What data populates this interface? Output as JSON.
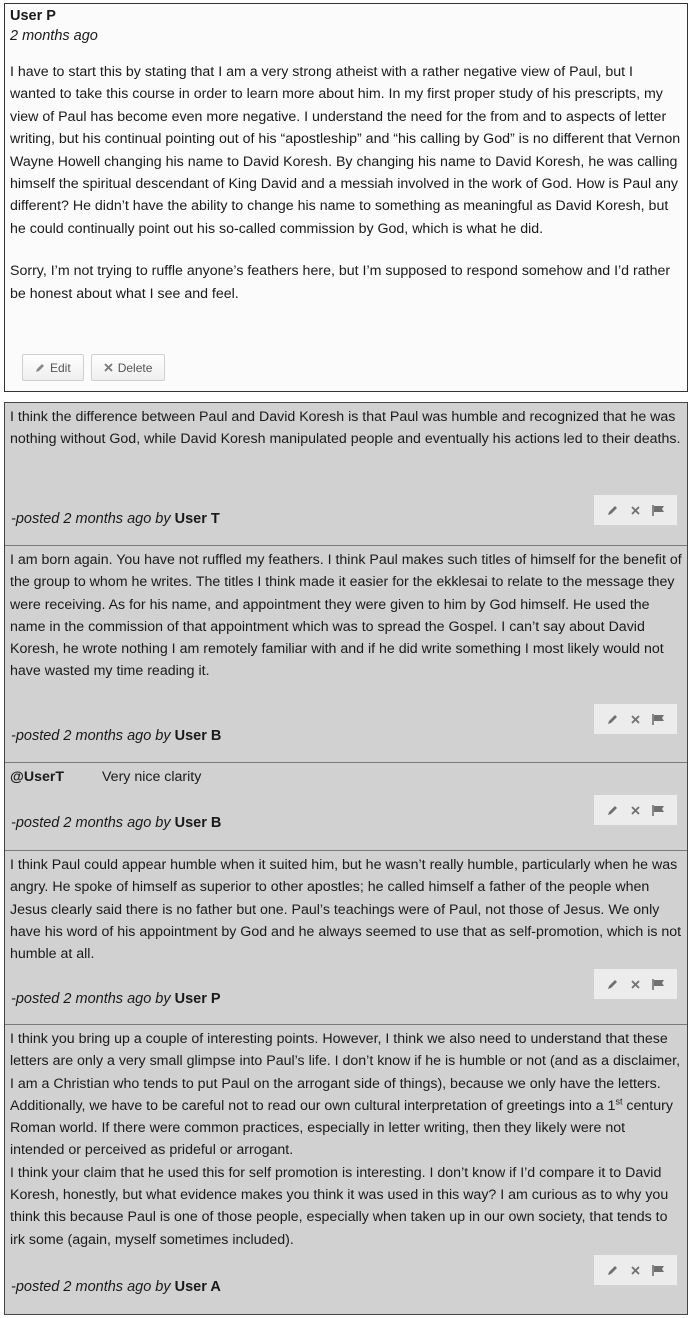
{
  "post": {
    "author": "User P",
    "time": "2 months ago",
    "paragraph1": "I have to start this by stating that I am a very strong atheist with a rather negative view of Paul, but I wanted to take this course in order to learn more about him. In my first proper study of his prescripts, my view of Paul has become even more negative. I understand the need for the from and to aspects of letter writing, but his continual pointing out of his “apostleship” and “his calling by God” is no different that Vernon Wayne Howell changing his name to David Koresh. By changing his name to David Koresh, he was calling himself the spiritual descendant of King David and a messiah involved in the work of God. How is Paul any different? He didn’t have the ability to change his name to something as meaningful as David Koresh, but he could continually point out his so-called commission by God, which is what he did.",
    "paragraph2": "Sorry, I’m not trying to ruffle anyone’s feathers here, but I’m supposed to respond somehow and I’d rather be honest about what I see and feel.",
    "edit_label": "Edit",
    "delete_label": "Delete"
  },
  "replies": [
    {
      "text": "I think the difference between Paul and David Koresh is that Paul was humble and recognized that he was nothing without God, while David Koresh manipulated people and eventually his actions led to their deaths.",
      "meta_prefix": "-posted 2 months ago by ",
      "user": "User T"
    },
    {
      "text": "I am born again. You have not ruffled my feathers. I think Paul makes such titles of himself for the benefit of the group to whom he writes. The titles I think made it easier for the ekklesai to relate to the message they were receiving. As for his name, and appointment they were given to him by God himself. He used the name in the commission of that appointment which was to spread the Gospel. I can’t say about David Koresh, he wrote nothing I am remotely familiar with and if he did write something I most likely would not have wasted my time reading it.",
      "meta_prefix": "-posted 2 months ago by ",
      "user": "User B"
    },
    {
      "mention": "@UserT",
      "text": "Very nice clarity",
      "meta_prefix": "-posted 2 months ago by ",
      "user": "User B"
    },
    {
      "text": "I think Paul could appear humble when it suited him, but he wasn’t really humble, particularly when he was angry. He spoke of himself as superior to other apostles; he called himself a father of the people when Jesus clearly said there is no father but one. Paul’s teachings were of Paul, not those of Jesus. We only have his word of his appointment by God and he always seemed to use that as self-promotion, which is not humble at all.",
      "meta_prefix": "-posted 2 months ago by ",
      "user": "User P"
    },
    {
      "text_before_sup": "I think you bring up a couple of interesting points. However, I think we also need to understand that these letters are only a very small glimpse into Paul’s life. I don’t know if he is humble or not (and as a disclaimer, I am a Christian who tends to put Paul on the arrogant side of things), because we only have the letters. Additionally, we have to be careful not to read our own cultural interpretation of greetings into a 1",
      "sup": "st",
      "text_after_sup": " century Roman world. If there were common practices, especially in letter writing, then they likely were not intended or perceived as prideful or arrogant.",
      "text2": "I think your claim that he used this for self promotion is interesting. I don’t know if I’d compare it to David Koresh, honestly, but what evidence makes you think it was used in this way? I am curious as to why you think this because Paul is one of those people, especially when taken up in our own society, that tends to irk some (again, myself sometimes included).",
      "meta_prefix": "-posted 2 months ago by ",
      "user": "User A"
    }
  ],
  "icons": {
    "edit": "pencil-icon",
    "delete": "x-icon",
    "flag": "flag-icon"
  },
  "colors": {
    "reply_background": "#d1d1d1",
    "tools_background": "#ececec",
    "border": "#444444"
  }
}
